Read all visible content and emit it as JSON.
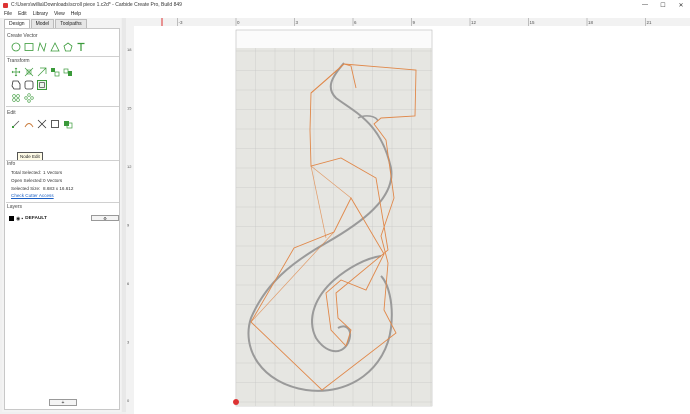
{
  "window": {
    "title": "C:\\Users\\willia\\Downloads\\scroll piece 1.c2d* - Carbide Create Pro, Build 849",
    "minimize": "—",
    "maximize": "☐",
    "close": "✕"
  },
  "menu": [
    "File",
    "Edit",
    "Library",
    "View",
    "Help"
  ],
  "tabs": [
    "Design",
    "Model",
    "Toolpaths"
  ],
  "sections": {
    "create_vector": "Create Vector",
    "transform": "Transform",
    "edit": "Edit",
    "info": "Info",
    "layers": "Layers"
  },
  "tooltip": "Node Edit",
  "info": {
    "total_selected_label": "Total Selected:",
    "total_selected_value": "1 Vectors",
    "open_selected_label": "Open Selected:",
    "open_selected_value": "0 Vectors",
    "selected_size_label": "Selected Size:",
    "selected_size_value": "8.683 x 16.612",
    "check_cutter": "Check Cutter Access"
  },
  "layers": {
    "name": "DEFAULT",
    "settings_button": "⚙",
    "add_button": "+"
  },
  "ruler": {
    "top_labels": [
      "-3",
      "0",
      "3",
      "6",
      "9",
      "12",
      "15",
      "18",
      "21"
    ],
    "left_labels": [
      "18",
      "15",
      "12",
      "9",
      "6",
      "3",
      "0"
    ]
  },
  "colors": {
    "accent": "#3a9a3a",
    "vector_orange": "#e0884a",
    "grid": "#c8c8c8",
    "stock": "#e6e6e2"
  }
}
